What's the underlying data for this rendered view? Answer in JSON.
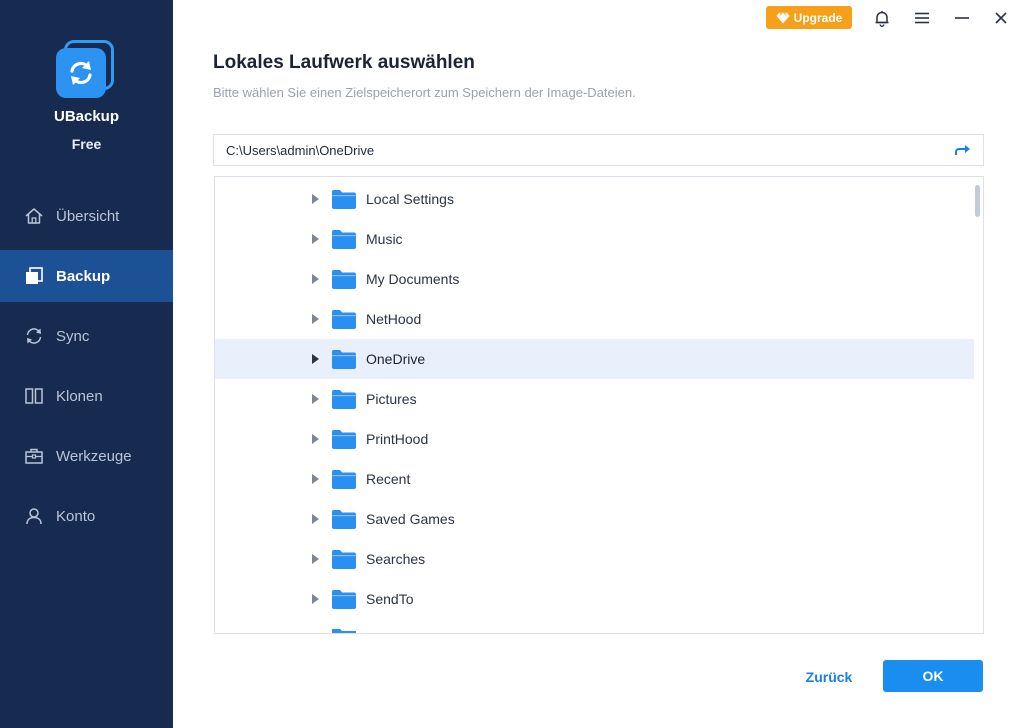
{
  "app": {
    "name": "UBackup",
    "edition": "Free"
  },
  "titlebar": {
    "upgrade_label": "Upgrade"
  },
  "sidebar": {
    "items": [
      {
        "label": "Übersicht",
        "icon": "home-icon",
        "active": false
      },
      {
        "label": "Backup",
        "icon": "backup-icon",
        "active": true
      },
      {
        "label": "Sync",
        "icon": "sync-icon",
        "active": false
      },
      {
        "label": "Klonen",
        "icon": "clone-icon",
        "active": false
      },
      {
        "label": "Werkzeuge",
        "icon": "toolbox-icon",
        "active": false
      },
      {
        "label": "Konto",
        "icon": "user-icon",
        "active": false
      }
    ]
  },
  "dialog": {
    "title": "Lokales Laufwerk auswählen",
    "subtitle": "Bitte wählen Sie einen Zielspeicherort zum Speichern der Image-Dateien.",
    "path_value": "C:\\Users\\admin\\OneDrive"
  },
  "tree": {
    "items": [
      {
        "label": "Local Settings",
        "selected": false
      },
      {
        "label": "Music",
        "selected": false
      },
      {
        "label": "My Documents",
        "selected": false
      },
      {
        "label": "NetHood",
        "selected": false
      },
      {
        "label": "OneDrive",
        "selected": true
      },
      {
        "label": "Pictures",
        "selected": false
      },
      {
        "label": "PrintHood",
        "selected": false
      },
      {
        "label": "Recent",
        "selected": false
      },
      {
        "label": "Saved Games",
        "selected": false
      },
      {
        "label": "Searches",
        "selected": false
      },
      {
        "label": "SendTo",
        "selected": false
      }
    ]
  },
  "buttons": {
    "back_label": "Zurück",
    "ok_label": "OK"
  },
  "colors": {
    "sidebar_bg": "#172b50",
    "sidebar_active": "#1d5196",
    "accent": "#1a8df0",
    "upgrade": "#f5a018",
    "folder": "#2b8ff0",
    "selected_row": "#e9f0fb"
  }
}
